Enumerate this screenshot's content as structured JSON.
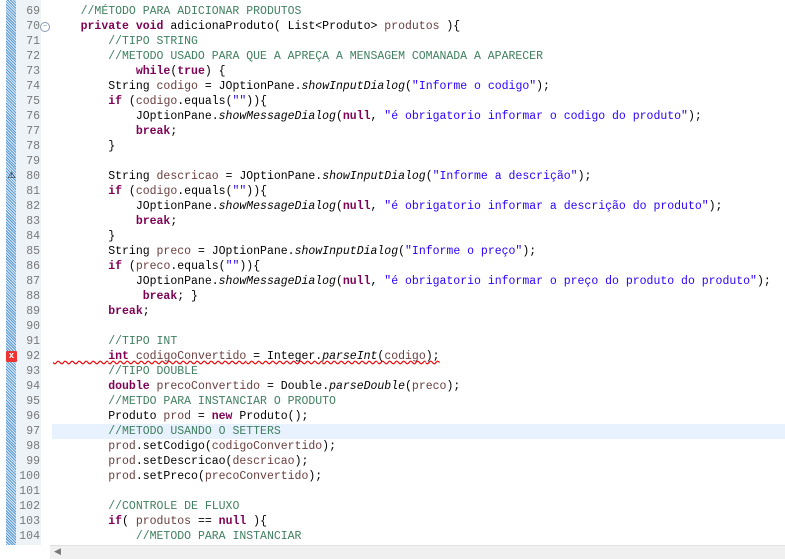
{
  "editor": {
    "lines": [
      {
        "n": "69",
        "t": [
          [
            "    ",
            ""
          ],
          [
            "//MÉTODO PARA ADICIONAR PRODUTOS",
            "c"
          ]
        ]
      },
      {
        "n": "70",
        "fold": "-",
        "t": [
          [
            "    ",
            ""
          ],
          [
            "private",
            "k"
          ],
          [
            " ",
            ""
          ],
          [
            "void",
            "k"
          ],
          [
            " adicionaProduto( List<Produto> ",
            ""
          ],
          [
            "produtos",
            "v"
          ],
          [
            " ){",
            ""
          ]
        ]
      },
      {
        "n": "71",
        "t": [
          [
            "        ",
            ""
          ],
          [
            "//TIPO STRING",
            "c"
          ]
        ]
      },
      {
        "n": "72",
        "t": [
          [
            "        ",
            ""
          ],
          [
            "//METODO USADO PARA QUE A APREÇA A MENSAGEM COMANADA A APARECER",
            "c"
          ]
        ]
      },
      {
        "n": "73",
        "t": [
          [
            "            ",
            ""
          ],
          [
            "while",
            "k"
          ],
          [
            "(",
            ""
          ],
          [
            "true",
            "k"
          ],
          [
            ") {",
            ""
          ]
        ]
      },
      {
        "n": "74",
        "t": [
          [
            "        String ",
            ""
          ],
          [
            "codigo",
            "v"
          ],
          [
            " = JOptionPane.",
            ""
          ],
          [
            "showInputDialog",
            "i"
          ],
          [
            "(",
            ""
          ],
          [
            "\"Informe o codigo\"",
            "s"
          ],
          [
            ");",
            ""
          ]
        ]
      },
      {
        "n": "75",
        "t": [
          [
            "        ",
            ""
          ],
          [
            "if",
            "k"
          ],
          [
            " (",
            ""
          ],
          [
            "codigo",
            "v"
          ],
          [
            ".equals(",
            ""
          ],
          [
            "\"\"",
            "s"
          ],
          [
            ")){",
            ""
          ]
        ]
      },
      {
        "n": "76",
        "t": [
          [
            "            JOptionPane.",
            ""
          ],
          [
            "showMessageDialog",
            "i"
          ],
          [
            "(",
            ""
          ],
          [
            "null",
            "k"
          ],
          [
            ", ",
            ""
          ],
          [
            "\"é obrigatorio informar o codigo do produto\"",
            "s"
          ],
          [
            ");",
            ""
          ]
        ]
      },
      {
        "n": "77",
        "t": [
          [
            "            ",
            ""
          ],
          [
            "break",
            "k"
          ],
          [
            ";",
            ""
          ]
        ]
      },
      {
        "n": "78",
        "t": [
          [
            "        }",
            ""
          ]
        ]
      },
      {
        "n": "79",
        "t": []
      },
      {
        "n": "80",
        "mark": "warning",
        "t": [
          [
            "        String ",
            ""
          ],
          [
            "descricao",
            "v"
          ],
          [
            " = JOptionPane.",
            ""
          ],
          [
            "showInputDialog",
            "i"
          ],
          [
            "(",
            ""
          ],
          [
            "\"Informe a descrição\"",
            "s"
          ],
          [
            ");",
            ""
          ]
        ]
      },
      {
        "n": "81",
        "t": [
          [
            "        ",
            ""
          ],
          [
            "if",
            "k"
          ],
          [
            " (",
            ""
          ],
          [
            "codigo",
            "v"
          ],
          [
            ".equals(",
            ""
          ],
          [
            "\"\"",
            "s"
          ],
          [
            ")){",
            ""
          ]
        ]
      },
      {
        "n": "82",
        "t": [
          [
            "            JOptionPane.",
            ""
          ],
          [
            "showMessageDialog",
            "i"
          ],
          [
            "(",
            ""
          ],
          [
            "null",
            "k"
          ],
          [
            ", ",
            ""
          ],
          [
            "\"é obrigatorio informar a descrição do produto\"",
            "s"
          ],
          [
            ");",
            ""
          ]
        ]
      },
      {
        "n": "83",
        "t": [
          [
            "            ",
            ""
          ],
          [
            "break",
            "k"
          ],
          [
            ";",
            ""
          ]
        ]
      },
      {
        "n": "84",
        "t": [
          [
            "        }",
            ""
          ]
        ]
      },
      {
        "n": "85",
        "t": [
          [
            "        String ",
            ""
          ],
          [
            "preco",
            "v"
          ],
          [
            " = JOptionPane.",
            ""
          ],
          [
            "showInputDialog",
            "i"
          ],
          [
            "(",
            ""
          ],
          [
            "\"Informe o preço\"",
            "s"
          ],
          [
            ");",
            ""
          ]
        ]
      },
      {
        "n": "86",
        "t": [
          [
            "        ",
            ""
          ],
          [
            "if",
            "k"
          ],
          [
            " (",
            ""
          ],
          [
            "preco",
            "v"
          ],
          [
            ".equals(",
            ""
          ],
          [
            "\"\"",
            "s"
          ],
          [
            ")){",
            ""
          ]
        ]
      },
      {
        "n": "87",
        "t": [
          [
            "            JOptionPane.",
            ""
          ],
          [
            "showMessageDialog",
            "i"
          ],
          [
            "(",
            ""
          ],
          [
            "null",
            "k"
          ],
          [
            ", ",
            ""
          ],
          [
            "\"é obrigatorio informar o preço do produto do produto\"",
            "s"
          ],
          [
            ");",
            ""
          ]
        ]
      },
      {
        "n": "88",
        "t": [
          [
            "             ",
            ""
          ],
          [
            "break",
            "k"
          ],
          [
            "; }",
            ""
          ]
        ]
      },
      {
        "n": "89",
        "t": [
          [
            "        ",
            ""
          ],
          [
            "break",
            "k"
          ],
          [
            ";",
            ""
          ]
        ]
      },
      {
        "n": "90",
        "t": []
      },
      {
        "n": "91",
        "t": [
          [
            "        ",
            ""
          ],
          [
            "//TIPO INT",
            "c"
          ]
        ]
      },
      {
        "n": "92",
        "mark": "error",
        "err": true,
        "t": [
          [
            "        ",
            ""
          ],
          [
            "int",
            "k"
          ],
          [
            " ",
            ""
          ],
          [
            "codigoConvertido",
            "v"
          ],
          [
            " = Integer.",
            ""
          ],
          [
            "parseInt",
            "i"
          ],
          [
            "(",
            ""
          ],
          [
            "codigo",
            "v"
          ],
          [
            ");",
            ""
          ]
        ]
      },
      {
        "n": "93",
        "t": [
          [
            "        ",
            ""
          ],
          [
            "//TIPO DOUBLE",
            "c"
          ]
        ]
      },
      {
        "n": "94",
        "t": [
          [
            "        ",
            ""
          ],
          [
            "double",
            "k"
          ],
          [
            " ",
            ""
          ],
          [
            "precoConvertido",
            "v"
          ],
          [
            " = Double.",
            ""
          ],
          [
            "parseDouble",
            "i"
          ],
          [
            "(",
            ""
          ],
          [
            "preco",
            "v"
          ],
          [
            ");",
            ""
          ]
        ]
      },
      {
        "n": "95",
        "t": [
          [
            "        ",
            ""
          ],
          [
            "//METDO PARA INSTANCIAR O PRODUTO",
            "c"
          ]
        ]
      },
      {
        "n": "96",
        "t": [
          [
            "        Produto ",
            ""
          ],
          [
            "prod",
            "v"
          ],
          [
            " = ",
            ""
          ],
          [
            "new",
            "k"
          ],
          [
            " Produto();",
            ""
          ]
        ]
      },
      {
        "n": "97",
        "current": true,
        "t": [
          [
            "        ",
            ""
          ],
          [
            "//METODO USANDO O SETTERS",
            "c"
          ]
        ]
      },
      {
        "n": "98",
        "t": [
          [
            "        ",
            ""
          ],
          [
            "prod",
            "v"
          ],
          [
            ".setCodigo(",
            ""
          ],
          [
            "codigoConvertido",
            "v"
          ],
          [
            ");",
            ""
          ]
        ]
      },
      {
        "n": "99",
        "t": [
          [
            "        ",
            ""
          ],
          [
            "prod",
            "v"
          ],
          [
            ".setDescricao(",
            ""
          ],
          [
            "descricao",
            "v"
          ],
          [
            ");",
            ""
          ]
        ]
      },
      {
        "n": "100",
        "t": [
          [
            "        ",
            ""
          ],
          [
            "prod",
            "v"
          ],
          [
            ".setPreco(",
            ""
          ],
          [
            "precoConvertido",
            "v"
          ],
          [
            ");",
            ""
          ]
        ]
      },
      {
        "n": "101",
        "t": []
      },
      {
        "n": "102",
        "t": [
          [
            "        ",
            ""
          ],
          [
            "//CONTROLE DE FLUXO",
            "c"
          ]
        ]
      },
      {
        "n": "103",
        "t": [
          [
            "        ",
            ""
          ],
          [
            "if",
            "k"
          ],
          [
            "( ",
            ""
          ],
          [
            "produtos",
            "v"
          ],
          [
            " == ",
            ""
          ],
          [
            "null",
            "k"
          ],
          [
            " ){",
            ""
          ]
        ]
      },
      {
        "n": "104",
        "t": [
          [
            "            ",
            ""
          ],
          [
            "//METODO PARA INSTANCIAR",
            "c"
          ]
        ]
      }
    ]
  },
  "icons": {
    "warning": "⚠",
    "error": "x",
    "fold": "−",
    "scroll_left": "◀"
  }
}
